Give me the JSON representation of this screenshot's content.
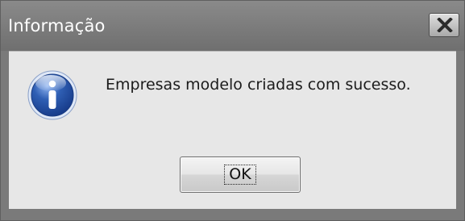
{
  "window": {
    "title": "Informação",
    "close_icon": "close-icon"
  },
  "message": {
    "icon": "info-icon",
    "text": "Empresas modelo criadas com sucesso."
  },
  "buttons": {
    "ok_label": "OK"
  },
  "colors": {
    "titlebar": "#7a7a7a",
    "content_background": "#e7e7e7",
    "info_icon_blue": "#2f5fb4",
    "text": "#1b1b1b"
  }
}
